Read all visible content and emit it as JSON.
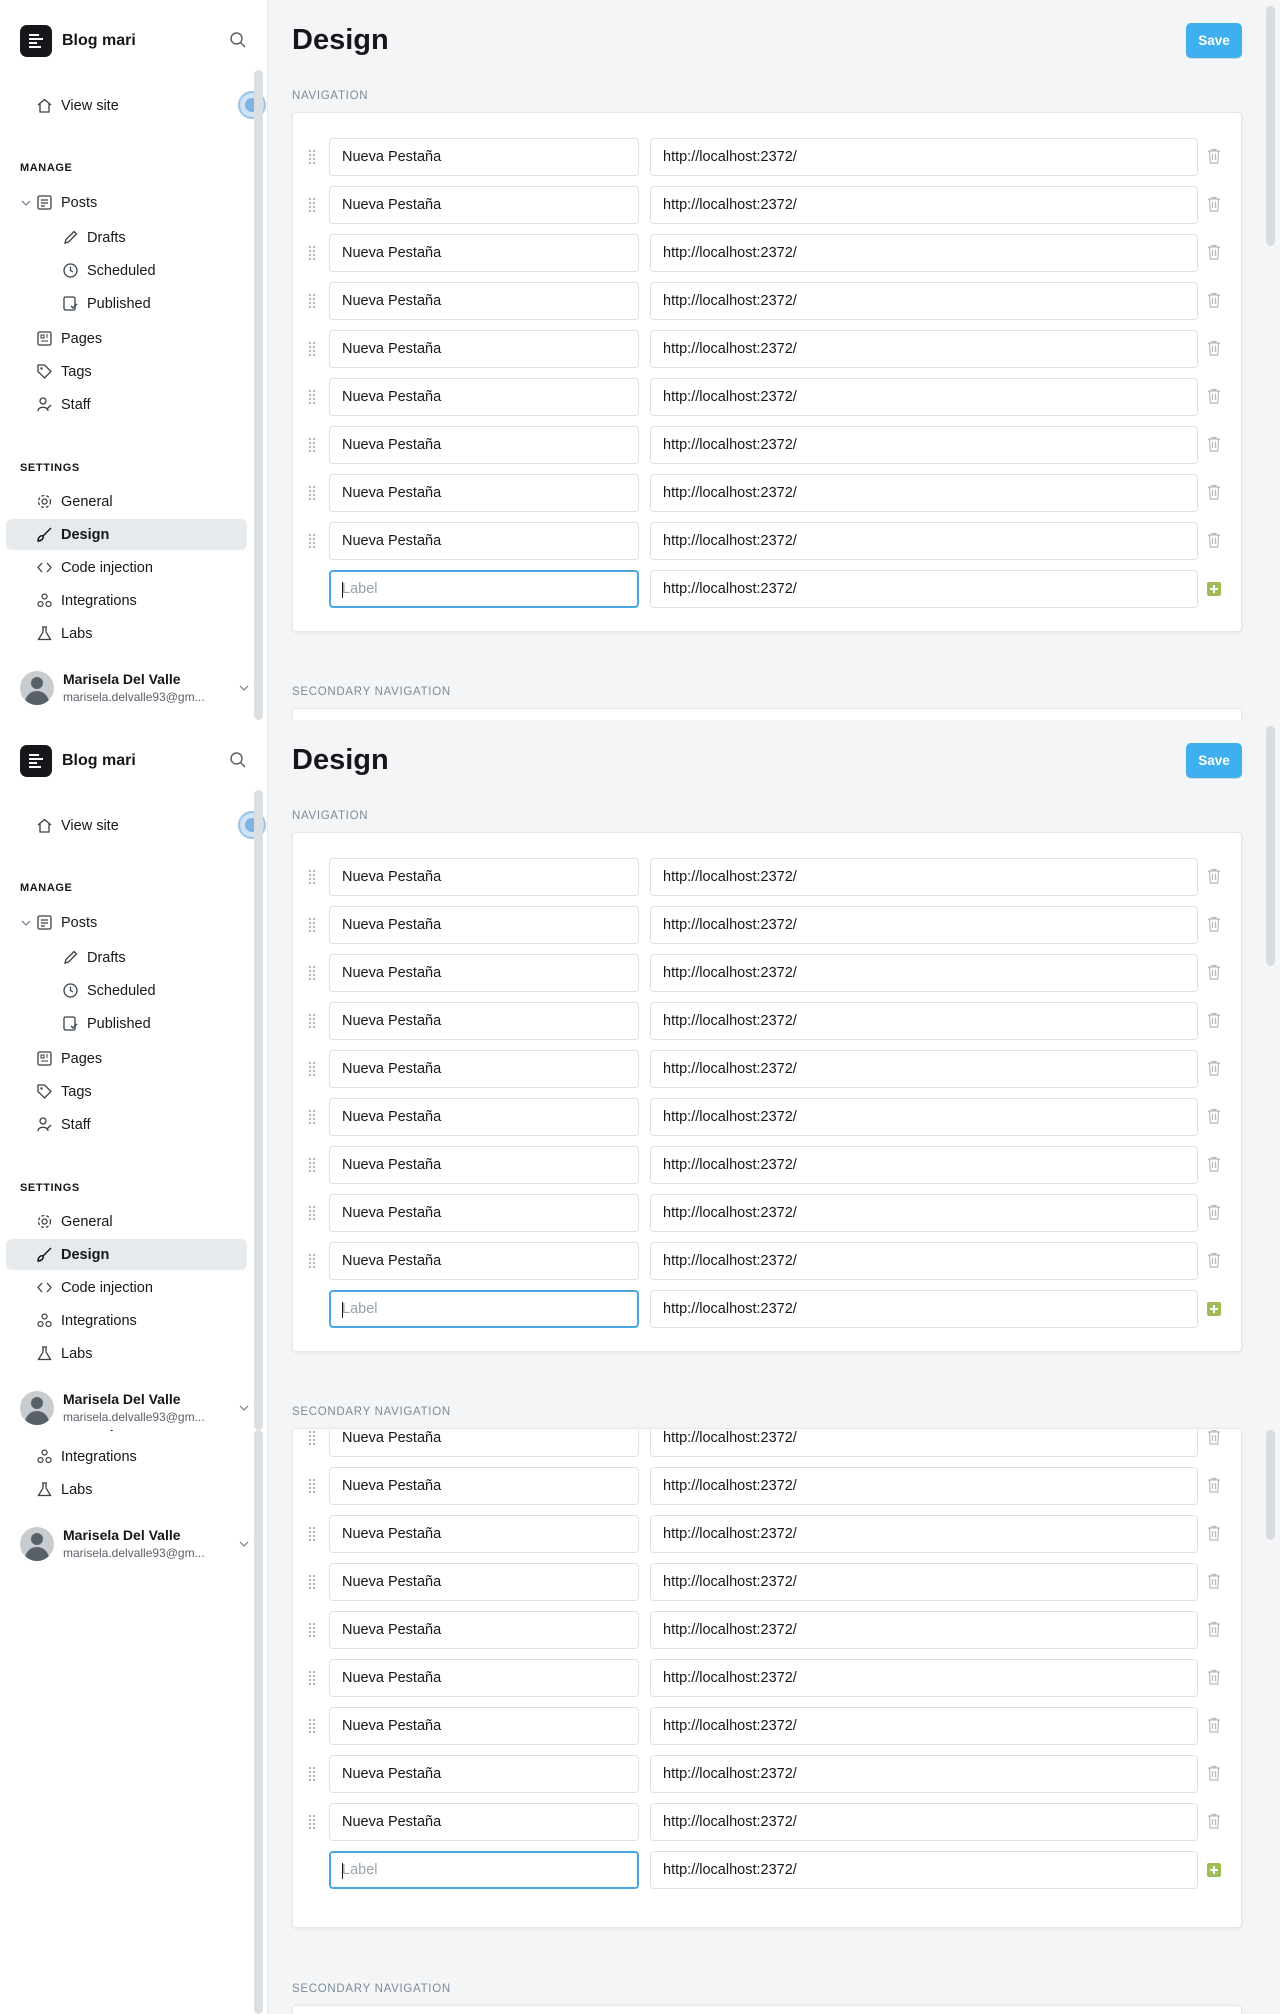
{
  "app": {
    "blog_title": "Blog mari",
    "page_title": "Design",
    "save_label": "Save"
  },
  "sidebar": {
    "view_site": "View site",
    "manage_label": "MANAGE",
    "settings_label": "SETTINGS",
    "posts": "Posts",
    "drafts": "Drafts",
    "scheduled": "Scheduled",
    "published": "Published",
    "pages": "Pages",
    "tags": "Tags",
    "staff": "Staff",
    "general": "General",
    "design": "Design",
    "code_injection": "Code injection",
    "integrations": "Integrations",
    "labs": "Labs"
  },
  "user": {
    "name": "Marisela Del Valle",
    "email": "marisela.delvalle93@gm..."
  },
  "navigation": {
    "section_label": "NAVIGATION",
    "secondary_label": "SECONDARY NAVIGATION",
    "item_label": "Nueva Pestaña",
    "item_url": "http://localhost:2372/",
    "new_label_placeholder": "Label",
    "new_url": "http://localhost:2372/"
  },
  "colors": {
    "accent": "#3eb0ef",
    "add_icon": "#9fbb58",
    "active_nav": "#e7eaed"
  }
}
